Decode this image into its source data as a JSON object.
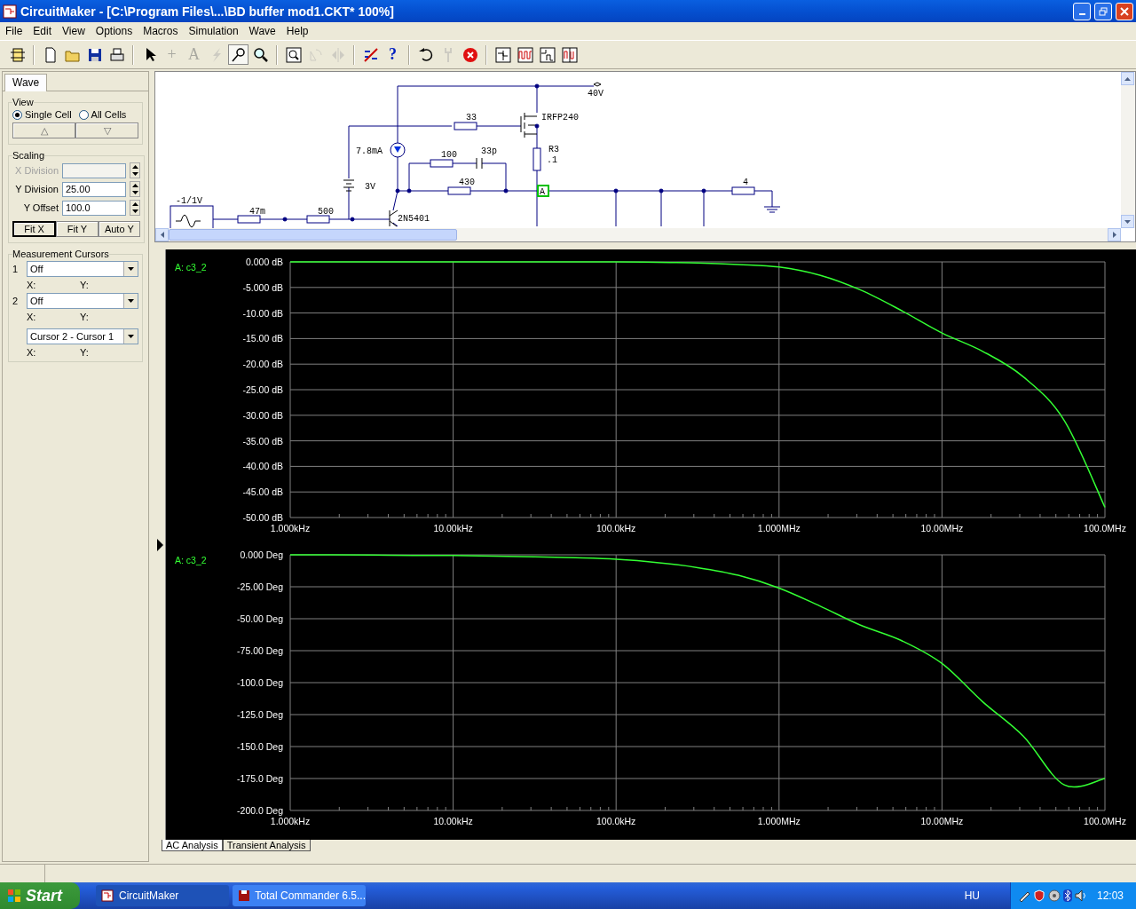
{
  "window": {
    "title": "CircuitMaker - [C:\\Program Files\\...\\BD buffer mod1.CKT* 100%]"
  },
  "menu": [
    "File",
    "Edit",
    "View",
    "Options",
    "Macros",
    "Simulation",
    "Wave",
    "Help"
  ],
  "toolbar": [
    [
      {
        "kind": "chip",
        "disabled": false,
        "pressed": false
      }
    ],
    [
      {
        "kind": "new",
        "disabled": false,
        "pressed": false
      },
      {
        "kind": "open",
        "disabled": false,
        "pressed": false
      },
      {
        "kind": "save",
        "disabled": false,
        "pressed": false
      },
      {
        "kind": "print",
        "disabled": false,
        "pressed": false
      }
    ],
    [
      {
        "kind": "pointer",
        "disabled": false,
        "pressed": false
      },
      {
        "kind": "wire",
        "label": "+",
        "disabled": true,
        "pressed": false
      },
      {
        "kind": "text",
        "label": "A",
        "disabled": true,
        "pressed": false
      },
      {
        "kind": "lightning",
        "disabled": true,
        "pressed": false
      },
      {
        "kind": "probe",
        "disabled": false,
        "pressed": true
      },
      {
        "kind": "zoom",
        "disabled": false,
        "pressed": false
      }
    ],
    [
      {
        "kind": "zoom-page",
        "disabled": false,
        "pressed": false
      },
      {
        "kind": "rotate",
        "disabled": true,
        "pressed": false
      },
      {
        "kind": "mirror",
        "disabled": true,
        "pressed": false
      }
    ],
    [
      {
        "kind": "analysis",
        "disabled": false,
        "pressed": false
      },
      {
        "kind": "help",
        "label": "?",
        "disabled": false,
        "pressed": false
      }
    ],
    [
      {
        "kind": "undo",
        "disabled": false,
        "pressed": false
      },
      {
        "kind": "wrench",
        "disabled": true,
        "pressed": false
      },
      {
        "kind": "stop",
        "disabled": false,
        "pressed": false
      }
    ],
    [
      {
        "kind": "schematic-view",
        "disabled": false,
        "pressed": false
      },
      {
        "kind": "wave-view",
        "disabled": false,
        "pressed": false
      },
      {
        "kind": "split-view",
        "disabled": false,
        "pressed": false
      },
      {
        "kind": "multi-view",
        "disabled": false,
        "pressed": false
      }
    ]
  ],
  "panel": {
    "tabs": [
      {
        "label": "Wave",
        "selected": true
      }
    ],
    "view": {
      "title": "View",
      "radios": [
        {
          "label": "Single Cell",
          "selected": true
        },
        {
          "label": "All Cells",
          "selected": false
        }
      ],
      "buttons": [
        "△",
        "▽"
      ]
    },
    "scaling": {
      "title": "Scaling",
      "fields": [
        {
          "label": "X Division",
          "disabled": true
        },
        {
          "label": "Y Division",
          "value": "25.00",
          "disabled": false
        },
        {
          "label": "Y Offset",
          "value": "100.0",
          "disabled": false
        }
      ],
      "buttons": [
        {
          "label": "Fit X",
          "default": true
        },
        {
          "label": "Fit Y",
          "default": false
        },
        {
          "label": "Auto Y",
          "default": false
        }
      ]
    },
    "cursors": {
      "title": "Measurement Cursors",
      "rows": [
        {
          "number": "1",
          "value": "Off",
          "x": "X:",
          "y": "Y:"
        },
        {
          "number": "2",
          "value": "Off",
          "x": "X:",
          "y": "Y:"
        },
        {
          "value": "Cursor 2 - Cursor 1",
          "x": "X:",
          "y": "Y:"
        }
      ]
    }
  },
  "schematic": {
    "labels": [
      "40V",
      "33",
      "IRFP240",
      "7.8mA",
      "100",
      "33p",
      "R3",
      ".1",
      "3V",
      "430",
      "4",
      "-1/1V",
      "47m",
      "500",
      "2N5401"
    ],
    "probe": "A"
  },
  "plots": [
    {
      "chart_data": {
        "type": "line",
        "categories": [
          "1.000kHz",
          null,
          null,
          null,
          "10.00kHz",
          null,
          null,
          null,
          "100.0kHz",
          null,
          null,
          null,
          "1.000MHz",
          null,
          null,
          null,
          "10.00MHz",
          null,
          null,
          null,
          "100.0MHz"
        ],
        "series": [
          {
            "name": "A: c3_2",
            "color": "#33ff33",
            "values": [
              0,
              0,
              0,
              0,
              0,
              0,
              0,
              0,
              0,
              -0.1,
              -0.2,
              -0.5,
              -1,
              -2.6,
              -5.5,
              -9.5,
              -13.9,
              -17.5,
              -22.5,
              -31,
              -48
            ]
          }
        ],
        "ylim": [
          -50,
          0
        ],
        "grid": true,
        "yticks": [
          {
            "value": 0,
            "label": "0.000 dB"
          },
          {
            "value": -5,
            "label": "-5.000 dB"
          },
          {
            "value": -10,
            "label": "-10.00 dB"
          },
          {
            "value": -15,
            "label": "-15.00 dB"
          },
          {
            "value": -20,
            "label": "-20.00 dB"
          },
          {
            "value": -25,
            "label": "-25.00 dB"
          },
          {
            "value": -30,
            "label": "-30.00 dB"
          },
          {
            "value": -35,
            "label": "-35.00 dB"
          },
          {
            "value": -40,
            "label": "-40.00 dB"
          },
          {
            "value": -45,
            "label": "-45.00 dB"
          },
          {
            "value": -50,
            "label": "-50.00 dB"
          }
        ]
      }
    },
    {
      "chart_data": {
        "type": "line",
        "categories": [
          "1.000kHz",
          null,
          null,
          null,
          "10.00kHz",
          null,
          null,
          null,
          "100.0kHz",
          null,
          null,
          null,
          "1.000MHz",
          null,
          null,
          null,
          "10.00MHz",
          null,
          null,
          null,
          "100.0MHz"
        ],
        "series": [
          {
            "name": "A: c3_2",
            "color": "#33ff33",
            "values": [
              0,
              0,
              -0.2,
              -0.5,
              -0.5,
              -1,
              -1.5,
              -2.3,
              -3.5,
              -6,
              -10,
              -16,
              -26,
              -40,
              -55,
              -67,
              -85,
              -115,
              -142,
              -180,
              -175
            ]
          }
        ],
        "ylim": [
          -200,
          0
        ],
        "grid": true,
        "yticks": [
          {
            "value": 0,
            "label": "0.000 Deg"
          },
          {
            "value": -25,
            "label": "-25.00 Deg"
          },
          {
            "value": -50,
            "label": "-50.00 Deg"
          },
          {
            "value": -75,
            "label": "-75.00 Deg"
          },
          {
            "value": -100,
            "label": "-100.0 Deg"
          },
          {
            "value": -125,
            "label": "-125.0 Deg"
          },
          {
            "value": -150,
            "label": "-150.0 Deg"
          },
          {
            "value": -175,
            "label": "-175.0 Deg"
          },
          {
            "value": -200,
            "label": "-200.0 Deg"
          }
        ]
      }
    }
  ],
  "analysis_tabs": [
    {
      "label": "AC Analysis",
      "selected": true
    },
    {
      "label": "Transient Analysis",
      "selected": false
    }
  ],
  "taskbar": {
    "start": "Start",
    "tasks": [
      {
        "label": "CircuitMaker",
        "kind": "circuit",
        "selected": true
      },
      {
        "label": "Total Commander 6.5...",
        "kind": "disk",
        "selected": false
      }
    ],
    "language": "HU",
    "clock": "12:03"
  }
}
